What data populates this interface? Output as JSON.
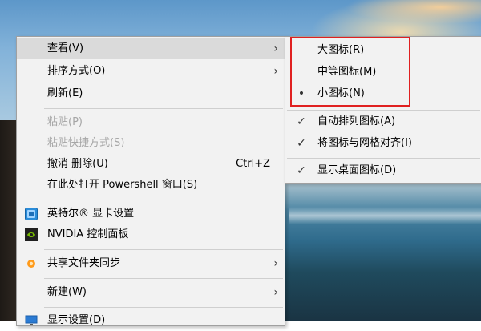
{
  "context_menu": {
    "items": [
      {
        "label": "查看(V)",
        "has_submenu": true,
        "state": "hover"
      },
      {
        "label": "排序方式(O)",
        "has_submenu": true
      },
      {
        "label": "刷新(E)"
      },
      {
        "label": "粘贴(P)",
        "state": "disabled"
      },
      {
        "label": "粘贴快捷方式(S)",
        "state": "disabled"
      },
      {
        "label": "撤消 删除(U)",
        "shortcut": "Ctrl+Z"
      },
      {
        "label": "在此处打开 Powershell 窗口(S)"
      },
      {
        "label": "英特尔® 显卡设置",
        "icon": "intel-graphics-icon"
      },
      {
        "label": "NVIDIA 控制面板",
        "icon": "nvidia-icon"
      },
      {
        "label": "共享文件夹同步",
        "icon": "share-sync-icon",
        "has_submenu": true
      },
      {
        "label": "新建(W)",
        "has_submenu": true
      },
      {
        "label": "显示设置(D)",
        "icon": "display-settings-icon"
      }
    ],
    "arrow_glyph": "›",
    "shortcut_undo": "Ctrl+Z"
  },
  "view_submenu": {
    "items": [
      {
        "label": "大图标(R)"
      },
      {
        "label": "中等图标(M)"
      },
      {
        "label": "小图标(N)",
        "mark": "•",
        "selected": true
      },
      {
        "label": "自动排列图标(A)",
        "mark": "✓",
        "checked": true
      },
      {
        "label": "将图标与网格对齐(I)",
        "mark": "✓",
        "checked": true
      },
      {
        "label": "显示桌面图标(D)",
        "mark": "✓",
        "checked": true
      }
    ]
  },
  "colors": {
    "menu_bg": "#f2f2f2",
    "hover_bg": "#dadada",
    "disabled_text": "#a6a6a6",
    "highlight_border": "#e02020"
  }
}
